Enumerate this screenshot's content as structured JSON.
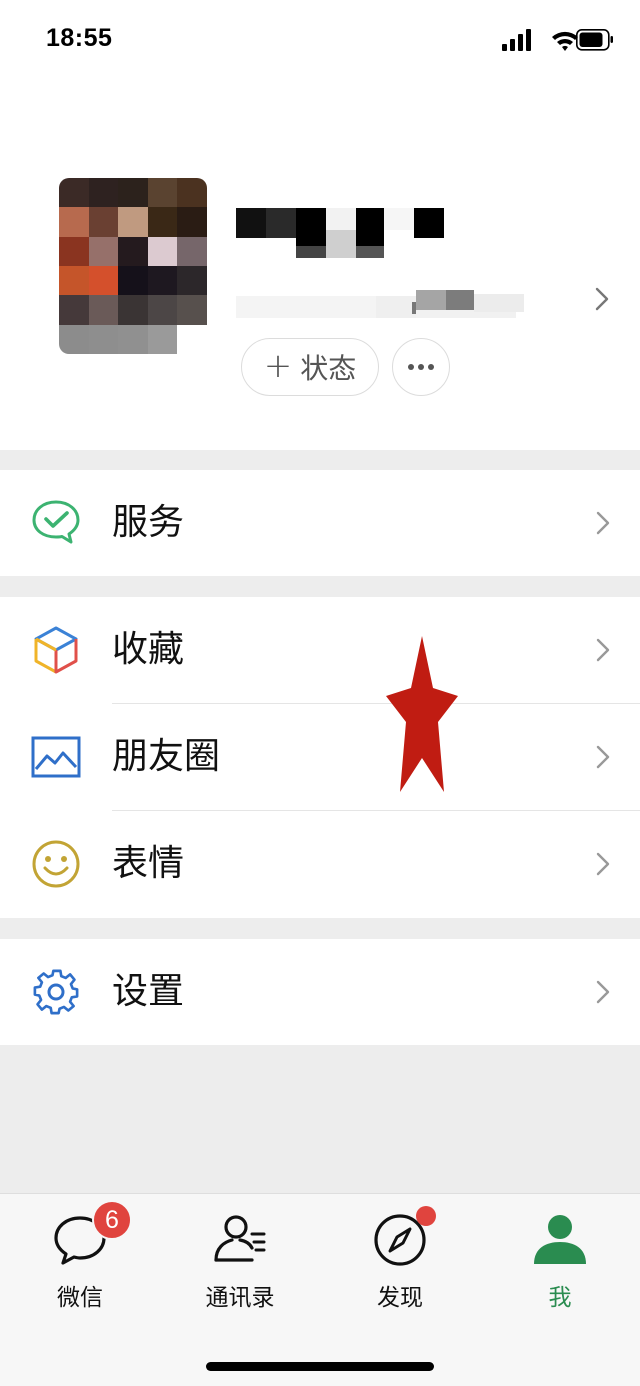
{
  "status_bar": {
    "time": "18:55",
    "icons": [
      "signal-icon",
      "wifi-icon",
      "battery-icon"
    ]
  },
  "profile": {
    "avatar_pixel_colors": [
      "#3b2a26",
      "#2e2220",
      "#2c221c",
      "#5a4330",
      "#4b3220",
      "#b76a4e",
      "#6a4032",
      "#c09a80",
      "#3a2816",
      "#2a1c14",
      "#8a3420",
      "#96706a",
      "#241a1e",
      "#dccad0",
      "#76666a",
      "#c5552a",
      "#d4502c",
      "#15111a",
      "#1e1820",
      "#2c272a",
      "#45393a",
      "#6a5a58",
      "#3a3434",
      "#4c4646",
      "#57504d",
      "#8c8c8c",
      "#8e8e8e",
      "#909090",
      "#9a9a9a",
      "#ffffff"
    ],
    "status_button_label": "状态",
    "more_button_icon": "ellipsis-icon"
  },
  "menu": {
    "service": {
      "label": "服务",
      "icon": "wechat-pay-icon",
      "icon_color": "#3cb371"
    },
    "favorites": {
      "label": "收藏",
      "icon": "cube-icon"
    },
    "moments": {
      "label": "朋友圈",
      "icon": "image-icon",
      "icon_color": "#2f6fc9"
    },
    "stickers": {
      "label": "表情",
      "icon": "smiley-icon",
      "icon_color": "#c2a435"
    },
    "settings": {
      "label": "设置",
      "icon": "gear-icon",
      "icon_color": "#2f6fc9"
    }
  },
  "tab_bar": {
    "tabs": [
      {
        "label": "微信",
        "icon": "chat-bubble-icon",
        "badge": "6"
      },
      {
        "label": "通讯录",
        "icon": "contacts-icon"
      },
      {
        "label": "发现",
        "icon": "compass-icon",
        "dot": true
      },
      {
        "label": "我",
        "icon": "person-icon",
        "active": true
      }
    ],
    "active_color": "#2a8c50",
    "badge_color": "#e0443e"
  },
  "annotation": {
    "shape": "star",
    "color": "#c01c12"
  }
}
